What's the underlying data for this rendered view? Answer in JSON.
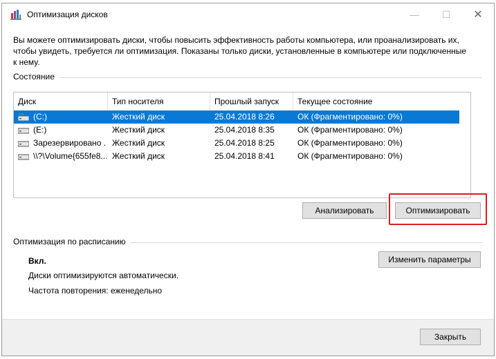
{
  "window": {
    "title": "Оптимизация дисков",
    "minimize_glyph": "—",
    "maximize_glyph": "☐",
    "close_glyph": "✕"
  },
  "description": "Вы можете оптимизировать диски, чтобы повысить эффективность работы  компьютера, или проанализировать их, чтобы увидеть, требуется ли оптимизация. Показаны только диски, установленные в компьютере или подключенные к нему.",
  "status_section": {
    "label": "Состояние",
    "columns": [
      "Диск",
      "Тип носителя",
      "Прошлый запуск",
      "Текущее состояние"
    ],
    "rows": [
      {
        "disk": "(C:)",
        "media": "Жесткий диск",
        "last_run": "25.04.2018 8:26",
        "state": "ОК (Фрагментировано: 0%)",
        "icon": "system-drive-icon",
        "selected": true
      },
      {
        "disk": "(E:)",
        "media": "Жесткий диск",
        "last_run": "25.04.2018 8:35",
        "state": "ОК (Фрагментировано: 0%)",
        "icon": "drive-icon",
        "selected": false
      },
      {
        "disk": "Зарезервировано ...",
        "media": "Жесткий диск",
        "last_run": "25.04.2018 8:25",
        "state": "ОК (Фрагментировано: 0%)",
        "icon": "drive-icon",
        "selected": false
      },
      {
        "disk": "\\\\?\\Volume{655fe8...",
        "media": "Жесткий диск",
        "last_run": "25.04.2018 8:41",
        "state": "ОК (Фрагментировано: 0%)",
        "icon": "drive-icon",
        "selected": false
      }
    ],
    "analyze_button": "Анализировать",
    "optimize_button": "Оптимизировать"
  },
  "schedule_section": {
    "label": "Оптимизация по расписанию",
    "status": "Вкл.",
    "auto_text": "Диски оптимизируются автоматически.",
    "frequency_text": "Частота повторения: еженедельно",
    "change_button": "Изменить параметры"
  },
  "footer": {
    "close_button": "Закрыть"
  },
  "colors": {
    "selection": "#0a79d3",
    "highlight": "#d81e1e",
    "button_bg": "#e1e1e1"
  }
}
